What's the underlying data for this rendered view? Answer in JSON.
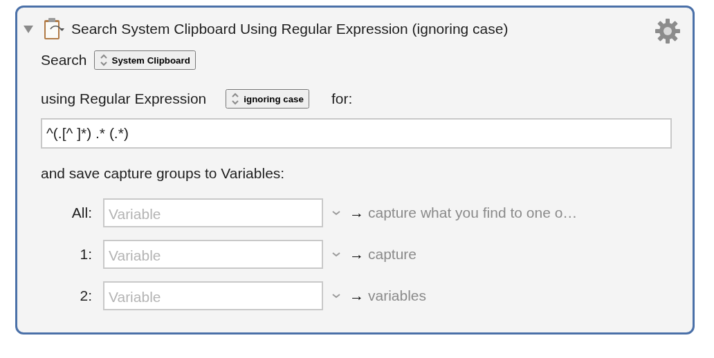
{
  "action": {
    "expanded": true,
    "title": "Search System Clipboard Using Regular Expression (ignoring case)",
    "search_label": "Search",
    "source": {
      "value": "System Clipboard"
    },
    "using_label": "using Regular Expression",
    "case_option": {
      "value": "ignoring case"
    },
    "for_label": "for:",
    "pattern": {
      "value": "^(.[^ ]*) .* (.*)"
    },
    "save_label": "and save capture groups to Variables:",
    "variables": [
      {
        "label": "All:",
        "placeholder": "Variable",
        "arrow": "→",
        "hint": "capture what you find to one o…"
      },
      {
        "label": "1:",
        "placeholder": "Variable",
        "arrow": "→",
        "hint": "capture"
      },
      {
        "label": "2:",
        "placeholder": "Variable",
        "arrow": "→",
        "hint": "variables"
      }
    ]
  }
}
